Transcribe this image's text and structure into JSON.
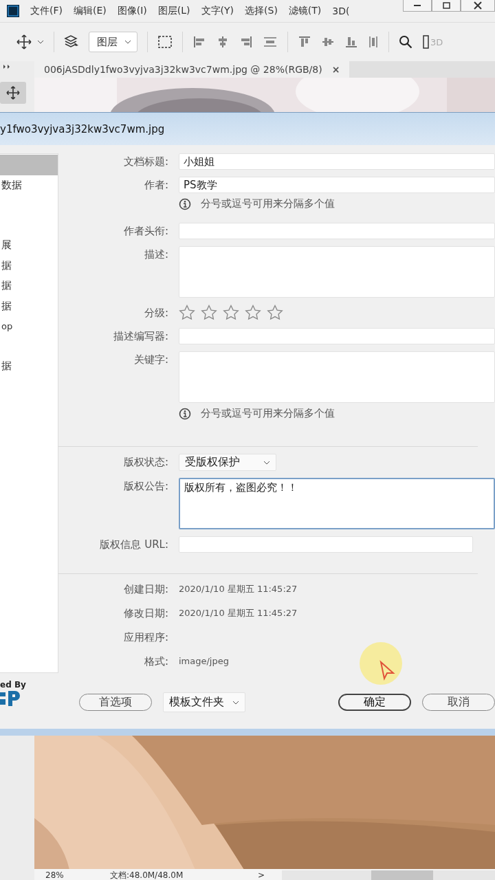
{
  "menu": [
    "文件(F)",
    "编辑(E)",
    "图像(I)",
    "图层(L)",
    "文字(Y)",
    "选择(S)",
    "滤镜(T)",
    "3D("
  ],
  "toolbar": {
    "dropdown": "图层",
    "mode_label": "3D"
  },
  "document_tab": {
    "title": "006jASDdly1fwo3vyjva3j32kw3vc7wm.jpg @ 28%(RGB/8)",
    "close": "×"
  },
  "tool_panel": {
    "move_tool_selected": true
  },
  "dialog": {
    "title": "y1fwo3vyjva3j32kw3vc7wm.jpg",
    "sidebar": [
      {
        "selected": true
      },
      {
        "label": "数据",
        "selected": false
      },
      {
        "label": "展",
        "selected": false
      },
      {
        "label": "据",
        "selected": false
      },
      {
        "label": "据",
        "selected": false
      },
      {
        "label": "据",
        "selected": false
      },
      {
        "label": "op",
        "selected": false
      },
      {
        "label": "据",
        "selected": false
      }
    ],
    "fields": [
      {
        "kind": "text",
        "label": "文档标题:",
        "value": "小姐姐"
      },
      {
        "kind": "text",
        "label": "作者:",
        "value": "PS教学"
      },
      {
        "kind": "hint",
        "text": "分号或逗号可用来分隔多个值"
      },
      {
        "kind": "text",
        "label": "作者头衔:"
      },
      {
        "kind": "textarea",
        "label": "描述:",
        "focused": false
      },
      {
        "kind": "stars",
        "label": "分级:",
        "stars": 0
      },
      {
        "kind": "text",
        "label": "描述编写器:"
      },
      {
        "kind": "textarea",
        "label": "关键字:",
        "focused": false
      },
      {
        "kind": "hint",
        "text": "分号或逗号可用来分隔多个值"
      },
      {
        "kind": "divider"
      },
      {
        "kind": "select",
        "label": "版权状态:",
        "value": "受版权保护"
      },
      {
        "kind": "textarea",
        "label": "版权公告:",
        "value": "版权所有，盗图必究！！",
        "focused": true
      },
      {
        "kind": "url",
        "label": "版权信息 URL:"
      },
      {
        "kind": "divider"
      },
      {
        "kind": "info",
        "label": "创建日期:",
        "value": "2020/1/10 星期五 11:45:27"
      },
      {
        "kind": "info",
        "label": "修改日期:",
        "value": "2020/1/10 星期五 11:45:27"
      },
      {
        "kind": "info",
        "label": "应用程序:"
      },
      {
        "kind": "info",
        "label": "格式:",
        "value": "image/jpeg"
      }
    ],
    "powered_by": "ed By",
    "buttons": [
      {
        "kind": "pill",
        "label": "首选项",
        "default": false
      },
      {
        "kind": "dropdown",
        "label": "模板文件夹"
      },
      {
        "kind": "pill",
        "label": "确定",
        "default": true
      },
      {
        "kind": "pill",
        "label": "取消",
        "default": false
      }
    ]
  },
  "status_bar": {
    "zoom": "28%",
    "doc_size": "文档:48.0M/48.0M",
    "arrow": ">"
  }
}
